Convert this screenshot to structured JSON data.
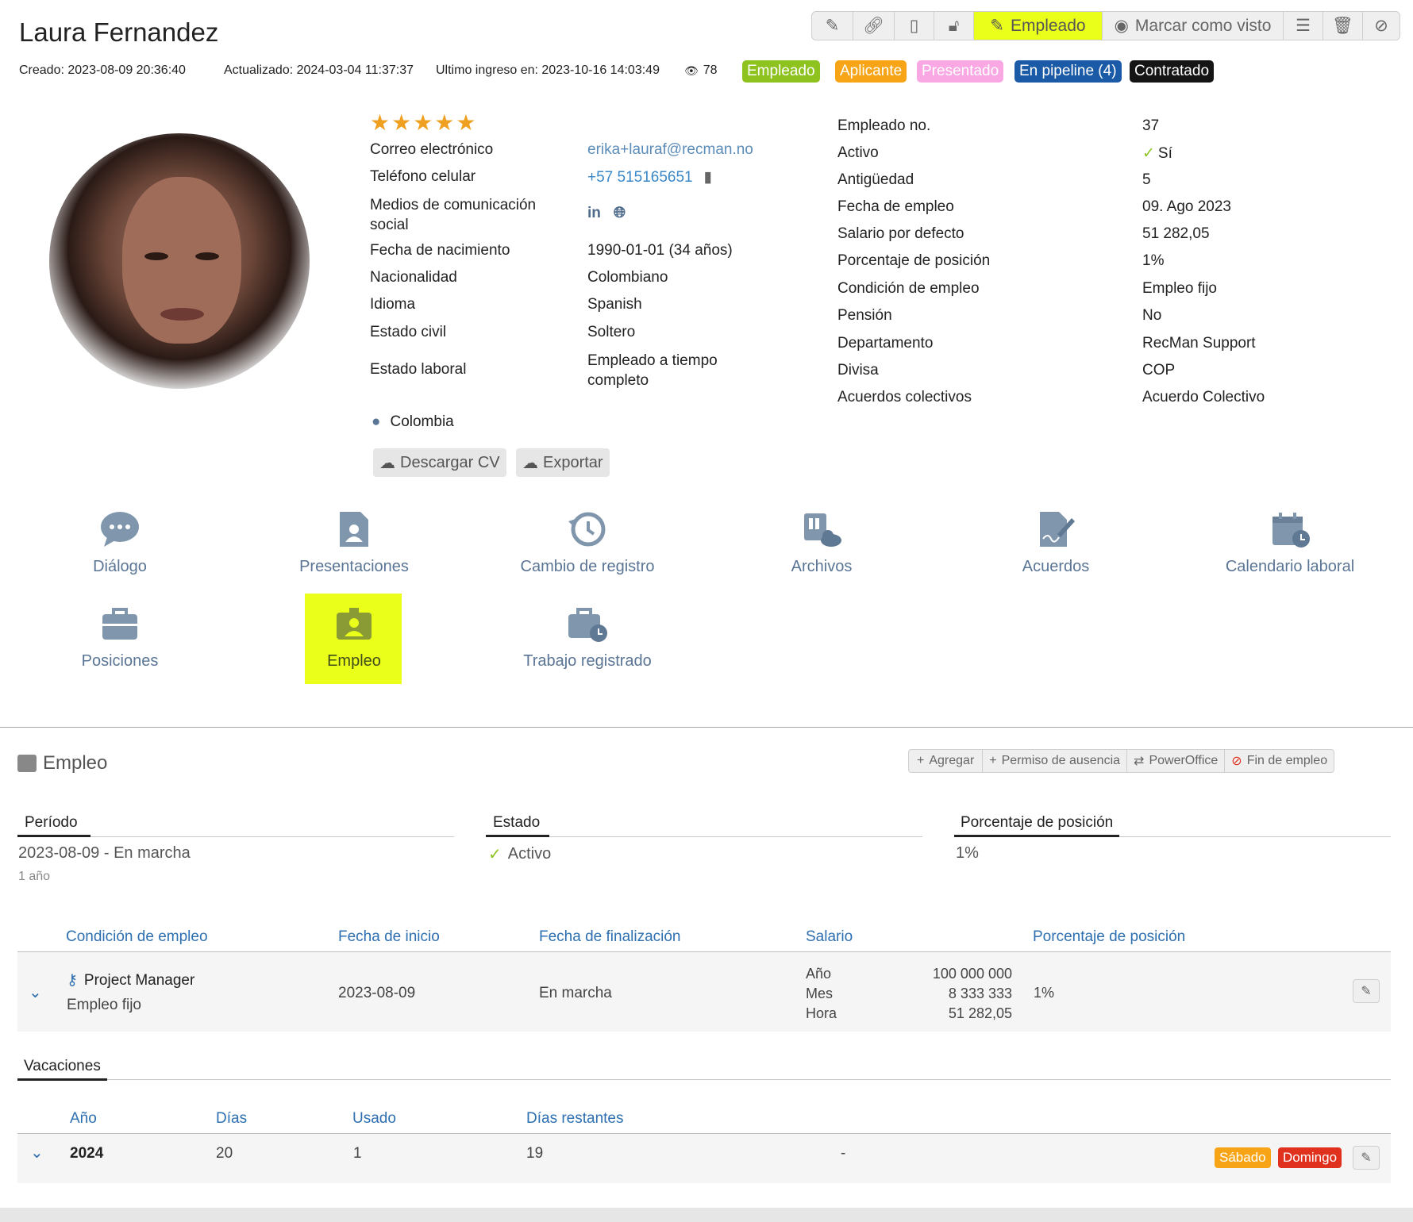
{
  "header": {
    "name": "Laura Fernandez",
    "created": "Creado: 2023-08-09 20:36:40",
    "updated": "Actualizado: 2024-03-04 11:37:37",
    "last_login": "Ultimo ingreso en: 2023-10-16 14:03:49",
    "views": "78",
    "tags": [
      {
        "label": "Empleado",
        "color": "#8dc21f"
      },
      {
        "label": "Aplicante",
        "color": "#f7a516"
      },
      {
        "label": "Presentado",
        "color": "#f9a8e4"
      },
      {
        "label": "En pipeline (4)",
        "color": "#1b5aa6"
      },
      {
        "label": "Contratado",
        "color": "#151515"
      }
    ]
  },
  "toolbar": {
    "employee_label": "Empleado",
    "mark_seen_label": "Marcar como visto",
    "icons": [
      "pencil-icon",
      "link-icon",
      "contact-card-icon",
      "unlock-icon",
      "pencil-icon",
      "eye-icon",
      "list-icon",
      "trash-icon",
      "ban-icon"
    ]
  },
  "rating": 5,
  "profile": {
    "email_label": "Correo electrónico",
    "email": "erika+lauraf@recman.no",
    "phone_label": "Teléfono celular",
    "phone": "+57 515165651",
    "social_label": "Medios de comunicación social",
    "birth_label": "Fecha de nacimiento",
    "birth": "1990-01-01 (34 años)",
    "nationality_label": "Nacionalidad",
    "nationality": "Colombiano",
    "language_label": "Idioma",
    "language": "Spanish",
    "civil_label": "Estado civil",
    "civil": "Soltero",
    "work_label": "Estado laboral",
    "work": "Empleado a tiempo completo",
    "location": "Colombia",
    "download_cv": "Descargar CV",
    "export": "Exportar"
  },
  "employment_info": [
    {
      "label": "Empleado no.",
      "value": "37"
    },
    {
      "label": "Activo",
      "value": "Sí"
    },
    {
      "label": "Antigüedad",
      "value": "5"
    },
    {
      "label": "Fecha de empleo",
      "value": "09. Ago 2023"
    },
    {
      "label": "Salario por defecto",
      "value": "51 282,05"
    },
    {
      "label": "Porcentaje de posición",
      "value": "1%"
    },
    {
      "label": "Condición de empleo",
      "value": "Empleo fijo"
    },
    {
      "label": "Pensión",
      "value": "No"
    },
    {
      "label": "Departamento",
      "value": "RecMan Support"
    },
    {
      "label": "Divisa",
      "value": "COP"
    },
    {
      "label": "Acuerdos colectivos",
      "value": "Acuerdo Colectivo"
    }
  ],
  "nav": [
    {
      "label": "Diálogo",
      "icon": "chat-bubble-icon"
    },
    {
      "label": "Presentaciones",
      "icon": "person-document-icon"
    },
    {
      "label": "Cambio de registro",
      "icon": "history-icon"
    },
    {
      "label": "Archivos",
      "icon": "files-cloud-icon"
    },
    {
      "label": "Acuerdos",
      "icon": "signed-document-icon"
    },
    {
      "label": "Calendario laboral",
      "icon": "calendar-clock-icon"
    },
    {
      "label": "Posiciones",
      "icon": "briefcase-icon"
    },
    {
      "label": "Empleo",
      "icon": "employee-badge-icon"
    },
    {
      "label": "Trabajo registrado",
      "icon": "briefcase-clock-icon"
    }
  ],
  "section": {
    "title": "Empleo",
    "actions": [
      "Agregar",
      "Permiso de ausencia",
      "PowerOffice",
      "Fin de empleo"
    ],
    "period_label": "Período",
    "period_value": "2023-08-09 - En marcha",
    "period_duration": "1 año",
    "status_label": "Estado",
    "status_value": "Activo",
    "position_pct_label": "Porcentaje de posición",
    "position_pct_value": "1%"
  },
  "employment_table": {
    "columns": [
      "Condición de empleo",
      "Fecha de inicio",
      "Fecha de finalización",
      "Salario",
      "Porcentaje de posición"
    ],
    "row": {
      "title": "Project Manager",
      "condition": "Empleo fijo",
      "start": "2023-08-09",
      "end": "En marcha",
      "salary": [
        {
          "unit": "Año",
          "amount": "100 000 000"
        },
        {
          "unit": "Mes",
          "amount": "8 333 333"
        },
        {
          "unit": "Hora",
          "amount": "51 282,05"
        }
      ],
      "pct": "1%"
    }
  },
  "vacation": {
    "title": "Vacaciones",
    "columns": [
      "Año",
      "Días",
      "Usado",
      "Días restantes"
    ],
    "row": {
      "year": "2024",
      "days": "20",
      "used": "1",
      "remaining": "19",
      "extra": "-"
    },
    "saturday": "Sábado",
    "sunday": "Domingo",
    "saturday_color": "#f7a516",
    "sunday_color": "#e0301e"
  },
  "colors": {
    "highlight": "#eaff1a",
    "link": "#3a87c8",
    "nav": "#5a7595"
  }
}
